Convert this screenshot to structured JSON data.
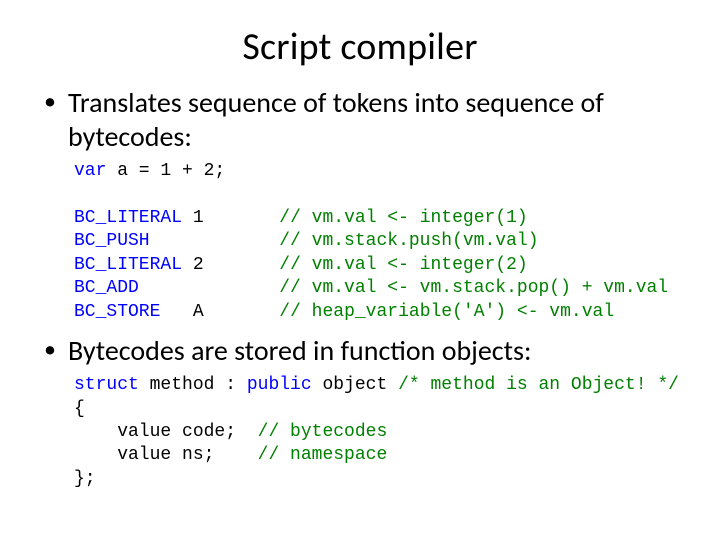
{
  "title": "Script compiler",
  "bullet1": "Translates sequence of tokens into sequence of bytecodes:",
  "code1": {
    "l1_kw": "var",
    "l1_rest": " a = 1 + 2;",
    "l2_op": "BC_LITERAL",
    "l2_arg": "1",
    "l2_cm": "// vm.val <- integer(1)",
    "l3_op": "BC_PUSH",
    "l3_arg": "",
    "l3_cm": "// vm.stack.push(vm.val)",
    "l4_op": "BC_LITERAL",
    "l4_arg": "2",
    "l4_cm": "// vm.val <- integer(2)",
    "l5_op": "BC_ADD",
    "l5_arg": "",
    "l5_cm": "// vm.val <- vm.stack.pop() + vm.val",
    "l6_op": "BC_STORE",
    "l6_arg": "A",
    "l6_cm": "// heap_variable('A') <- vm.val"
  },
  "bullet2": "Bytecodes are stored in function objects:",
  "code2": {
    "l1_kw1": "struct",
    "l1_mid": " method : ",
    "l1_kw2": "public",
    "l1_rest": " object ",
    "l1_cm": "/* method is an Object! */",
    "l2": "{",
    "l3_txt": "    value code;  ",
    "l3_cm": "// bytecodes",
    "l4_txt": "    value ns;    ",
    "l4_cm": "// namespace",
    "l5": "};"
  }
}
